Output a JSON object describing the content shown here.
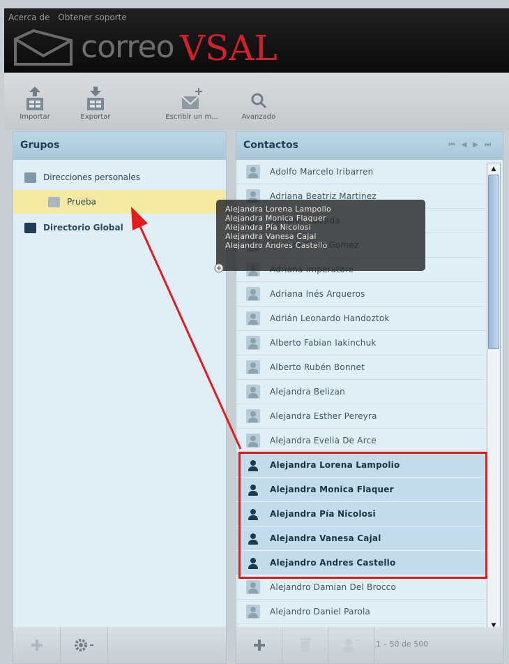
{
  "header": {
    "links": [
      "Acerca de",
      "Obtener soporte"
    ],
    "logo": {
      "part1": "correo",
      "part2": "VSAL"
    }
  },
  "toolbar": {
    "import_label": "Importar",
    "export_label": "Exportar",
    "compose_label": "Escribir un m...",
    "advanced_label": "Avanzado"
  },
  "groups_panel": {
    "title": "Grupos",
    "items": [
      {
        "label": "Direcciones personales"
      },
      {
        "label": "Prueba"
      },
      {
        "label": "Directorio Global"
      }
    ]
  },
  "contacts_panel": {
    "title": "Contactos",
    "pager": [
      "⏮",
      "◀",
      "▶",
      "⏭"
    ],
    "contacts": [
      {
        "name": "Adolfo Marcelo Iribarren",
        "selected": false
      },
      {
        "name": "Adriana Beatriz Martinez",
        "selected": false
      },
      {
        "name": "Adriana Calzada",
        "selected": false
      },
      {
        "name": "Adriana Elisa Gomez",
        "selected": false
      },
      {
        "name": "Adriana Imperatore",
        "selected": false
      },
      {
        "name": "Adriana Inés Arqueros",
        "selected": false
      },
      {
        "name": "Adrián Leonardo Handoztok",
        "selected": false
      },
      {
        "name": "Alberto Fabian Iakinchuk",
        "selected": false
      },
      {
        "name": "Alberto Rubén Bonnet",
        "selected": false
      },
      {
        "name": "Alejandra Belizan",
        "selected": false
      },
      {
        "name": "Alejandra Esther Pereyra",
        "selected": false
      },
      {
        "name": "Alejandra Evelia De Arce",
        "selected": false
      },
      {
        "name": "Alejandra Lorena Lampolio",
        "selected": true
      },
      {
        "name": "Alejandra Monica Flaquer",
        "selected": true
      },
      {
        "name": "Alejandra Pía Nicolosi",
        "selected": true
      },
      {
        "name": "Alejandra Vanesa Cajal",
        "selected": true
      },
      {
        "name": "Alejandro Andres Castello",
        "selected": true
      },
      {
        "name": "Alejandro Damian Del Brocco",
        "selected": false
      },
      {
        "name": "Alejandro Daniel Parola",
        "selected": false
      }
    ],
    "count_label": "1 – 50 de 500"
  },
  "drag_tooltip": {
    "lines": [
      "Alejandra Lorena Lampolio",
      "Alejandra Monica Flaquer",
      "Alejandra Pía Nicolosi",
      "Alejandra Vanesa Cajal",
      "Alejandro Andres Castello"
    ]
  },
  "colors": {
    "brand_red": "#d4202a",
    "annotation_red": "#e41a1a",
    "selected_group": "#f4eaa2",
    "selected_row": "#c3dceb"
  }
}
